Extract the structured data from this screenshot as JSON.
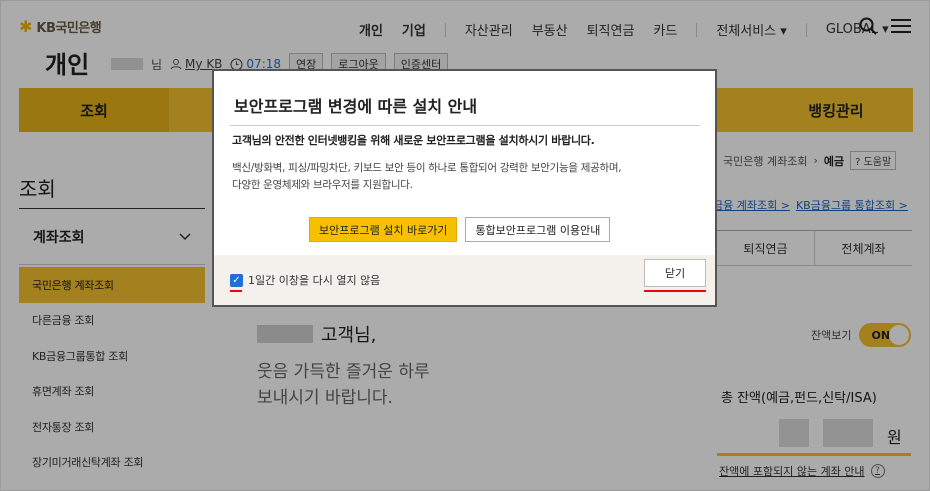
{
  "header": {
    "logo_text": "KB국민은행",
    "page_title": "개인",
    "user_suffix": "님",
    "mykb": "My KB",
    "session_time": "07:18",
    "extend": "연장",
    "logout": "로그아웃",
    "cert_center": "인증센터",
    "topnav": [
      "개인",
      "기업",
      "자산관리",
      "부동산",
      "퇴직연금",
      "카드",
      "전체서비스 ▾",
      "GLOBAL ▾"
    ]
  },
  "mainnav": {
    "selected": "조회",
    "right": "뱅킹관리"
  },
  "sidebar": {
    "title": "조회",
    "section": "계좌조회",
    "items": [
      {
        "label": "국민은행 계좌조회",
        "active": true
      },
      {
        "label": "다른금융 조회"
      },
      {
        "label": "KB금융그룹통합 조회"
      },
      {
        "label": "휴면계좌 조회"
      },
      {
        "label": "전자통장 조회"
      },
      {
        "label": "장기미거래신탁계좌 조회"
      }
    ]
  },
  "content": {
    "breadcrumb": [
      "국민은행 계좌조회",
      "예금"
    ],
    "help": "? 도움말",
    "links": [
      "금융 계좌조회 >",
      "KB금융그룹 통합조회 >"
    ],
    "tabs": [
      "퇴직연금",
      "전체계좌"
    ],
    "greeting_suffix": "고객님,",
    "greeting_msg_1": "웃음 가득한 즐거운 하루",
    "greeting_msg_2": "보내시기 바랍니다.",
    "balance_view": "잔액보기",
    "toggle": "ON",
    "total_label": "총 잔액(예금,펀드,신탁/ISA)",
    "currency": "원",
    "excluded_info": "잔액에 포함되지 않는 계좌 안내"
  },
  "modal": {
    "title": "보안프로그램 변경에 따른 설치 안내",
    "lead": "고객님의 안전한 인터넷뱅킹을 위해 새로운 보안프로그램을 설치하시기 바랍니다.",
    "desc_1": "백신/방화벽, 피싱/파밍차단, 키보드 보안 등이 하나로 통합되어 강력한 보안기능을 제공하며,",
    "desc_2": "다양한 운영체제와 브라우저를 지원합니다.",
    "install_button": "보안프로그램 설치 바로가기",
    "guide_button": "통합보안프로그램 이용안내",
    "no_show": "1일간 이창을 다시 열지 않음",
    "no_show_checked": true,
    "close_button": "닫기"
  },
  "colors": {
    "accent": "#f3c02d",
    "link": "#1d5fbf",
    "highlight": "#e01"
  }
}
